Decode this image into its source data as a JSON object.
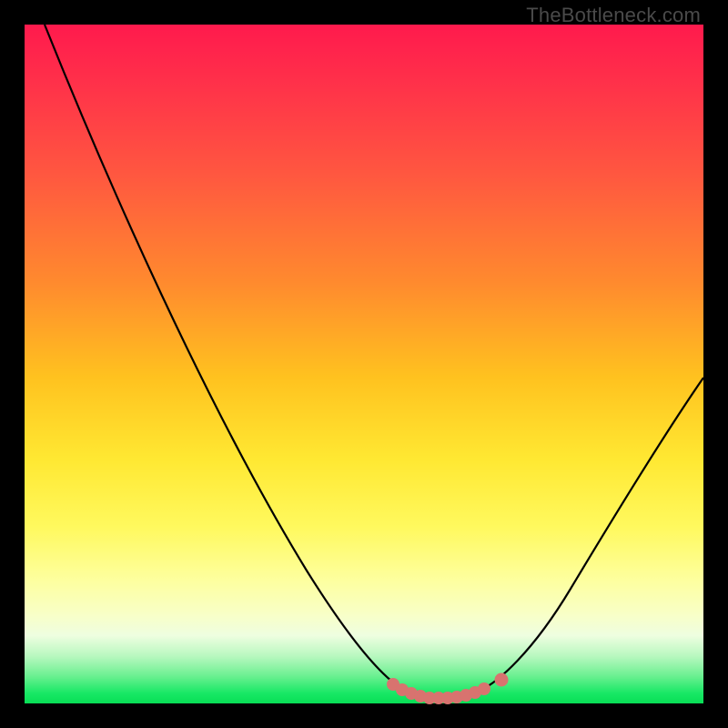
{
  "watermark": "TheBottleneck.com",
  "chart_data": {
    "type": "line",
    "title": "",
    "xlabel": "",
    "ylabel": "",
    "xlim": [
      0,
      100
    ],
    "ylim": [
      0,
      100
    ],
    "series": [
      {
        "name": "bottleneck-curve",
        "x": [
          3,
          10,
          20,
          30,
          40,
          48,
          54,
          58,
          62,
          66,
          70,
          74,
          80,
          88,
          100
        ],
        "y": [
          100,
          84,
          62,
          41,
          22,
          9,
          3,
          1.2,
          0.8,
          1.0,
          2.5,
          6,
          14,
          30,
          56
        ]
      },
      {
        "name": "highlight-dots",
        "x": [
          54.5,
          56,
          57.5,
          59,
          60.5,
          62,
          63.5,
          65,
          66.5,
          68,
          70.5
        ],
        "y": [
          3.0,
          2.2,
          1.6,
          1.2,
          1.0,
          0.9,
          0.9,
          1.0,
          1.2,
          1.6,
          2.6
        ]
      }
    ],
    "colors": {
      "curve": "#000000",
      "dots": "#d8736f"
    }
  }
}
